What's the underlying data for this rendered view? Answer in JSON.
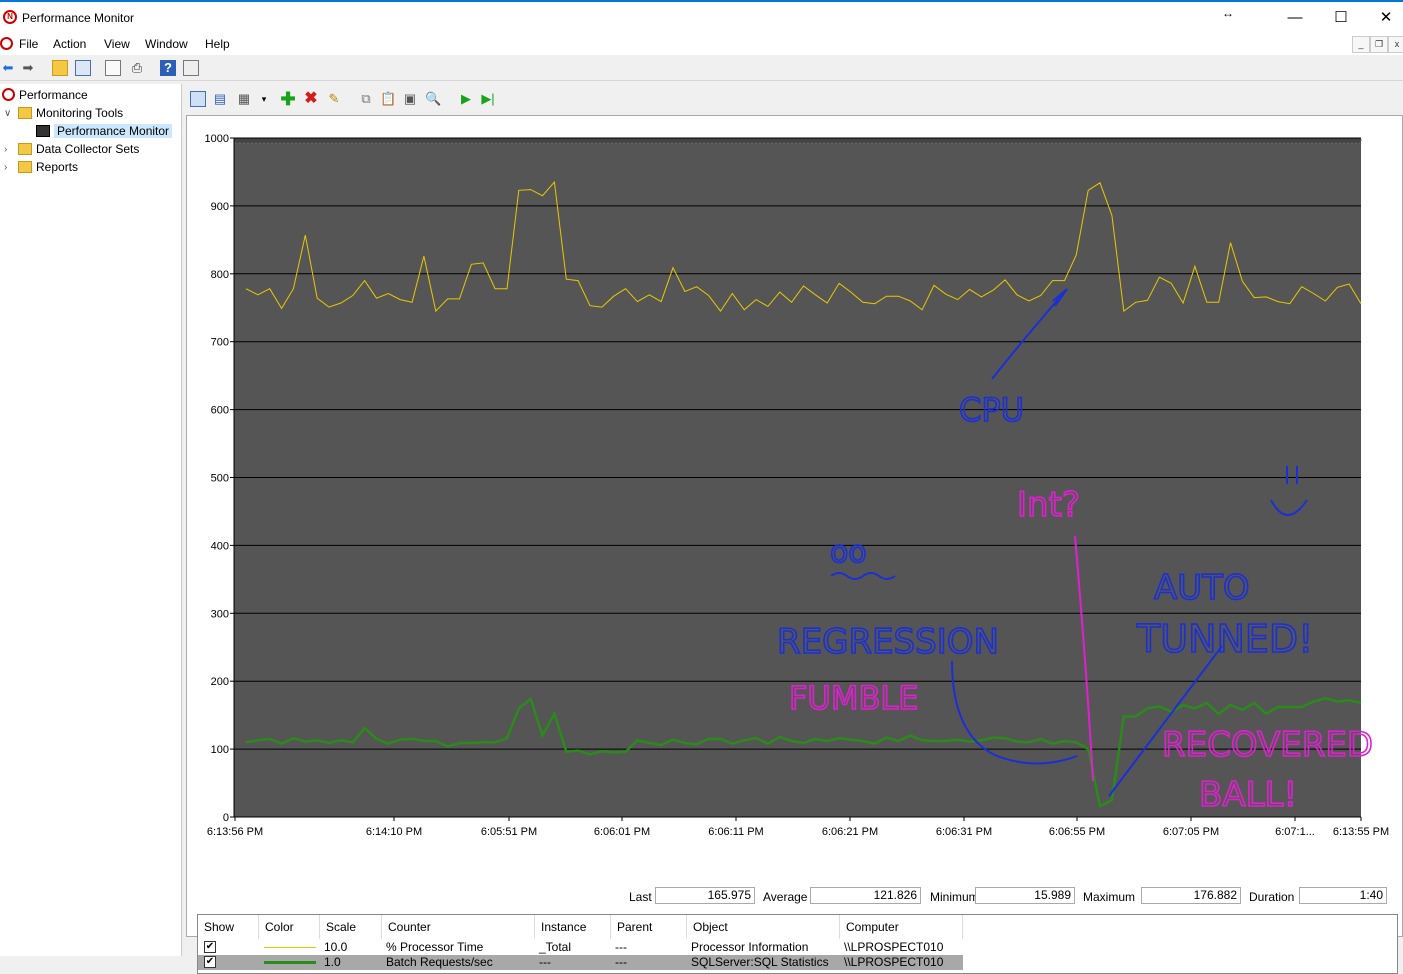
{
  "window": {
    "title": "Performance Monitor"
  },
  "menu": [
    "File",
    "Action",
    "View",
    "Window",
    "Help"
  ],
  "tree": {
    "root": "Performance",
    "monitoring_tools": "Monitoring Tools",
    "performance_monitor": "Performance Monitor",
    "data_collector_sets": "Data Collector Sets",
    "reports": "Reports"
  },
  "chart_data": {
    "type": "line",
    "ylim": [
      0,
      1000
    ],
    "yticks": [
      "1000",
      "900",
      "800",
      "700",
      "600",
      "500",
      "400",
      "300",
      "200",
      "100",
      "0"
    ],
    "xticks": [
      "6:13:56 PM",
      "6:14:10 PM",
      "6:05:51 PM",
      "6:06:01 PM",
      "6:06:11 PM",
      "6:06:21 PM",
      "6:06:31 PM",
      "6:06:55 PM",
      "6:07:05 PM",
      "6:07:1...",
      "6:13:55 PM"
    ],
    "grid": true,
    "series": [
      {
        "name": "% Processor Time",
        "color": "#e8c800",
        "values": [
          778,
          769,
          778,
          749,
          778,
          857,
          764,
          751,
          757,
          768,
          790,
          764,
          771,
          762,
          758,
          826,
          745,
          763,
          763,
          814,
          816,
          778,
          778,
          923,
          924,
          915,
          935,
          792,
          790,
          753,
          751,
          767,
          778,
          759,
          769,
          759,
          809,
          774,
          781,
          768,
          745,
          771,
          747,
          762,
          752,
          773,
          758,
          782,
          769,
          757,
          786,
          773,
          758,
          756,
          767,
          767,
          760,
          747,
          783,
          770,
          762,
          777,
          766,
          776,
          791,
          769,
          760,
          768,
          790,
          790,
          828,
          923,
          934,
          886,
          745,
          758,
          761,
          795,
          786,
          757,
          811,
          758,
          758,
          846,
          789,
          765,
          766,
          759,
          756,
          781,
          771,
          760,
          780,
          785,
          756
        ]
      },
      {
        "name": "Batch Requests/sec",
        "color": "#2a8a1a",
        "values": [
          110,
          113,
          115,
          108,
          116,
          111,
          113,
          109,
          113,
          110,
          131,
          115,
          108,
          114,
          115,
          112,
          112,
          104,
          109,
          109,
          110,
          110,
          116,
          160,
          174,
          120,
          152,
          96,
          98,
          92,
          97,
          95,
          96,
          113,
          109,
          106,
          114,
          109,
          107,
          115,
          115,
          108,
          113,
          116,
          108,
          118,
          112,
          109,
          115,
          112,
          116,
          114,
          112,
          108,
          117,
          112,
          120,
          113,
          112,
          112,
          114,
          111,
          113,
          117,
          116,
          111,
          110,
          115,
          108,
          112,
          110,
          100,
          16,
          25,
          148,
          148,
          160,
          163,
          155,
          165,
          160,
          168,
          152,
          165,
          158,
          168,
          152,
          162,
          162,
          162,
          170,
          175,
          170,
          172,
          168
        ]
      }
    ]
  },
  "stats": {
    "last_label": "Last",
    "last": "165.975",
    "average_label": "Average",
    "average": "121.826",
    "minimum_label": "Minimum",
    "minimum": "15.989",
    "maximum_label": "Maximum",
    "maximum": "176.882",
    "duration_label": "Duration",
    "duration": "1:40"
  },
  "legend": {
    "headers": [
      "Show",
      "Color",
      "Scale",
      "Counter",
      "Instance",
      "Parent",
      "Object",
      "Computer"
    ],
    "rows": [
      {
        "color": "#e8c800",
        "scale": "10.0",
        "counter": "% Processor Time",
        "instance": "_Total",
        "parent": "---",
        "object": "Processor Information",
        "computer": "\\\\LPROSPECT010"
      },
      {
        "color": "#2a8a1a",
        "scale": "1.0",
        "counter": "Batch Requests/sec",
        "instance": "---",
        "parent": "---",
        "object": "SQLServer:SQL Statistics",
        "computer": "\\\\LPROSPECT010"
      }
    ]
  }
}
